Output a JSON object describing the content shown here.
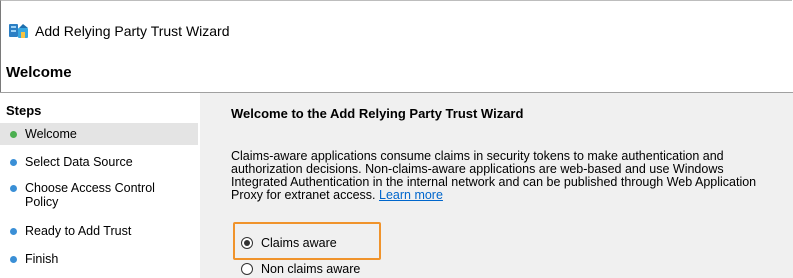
{
  "window": {
    "title": "Add Relying Party Trust Wizard",
    "icon": "relying-party-icon"
  },
  "header": {
    "title": "Welcome"
  },
  "sidebar": {
    "title": "Steps",
    "steps": [
      {
        "label": "Welcome",
        "color": "#4caf50",
        "current": true
      },
      {
        "label": "Select Data Source",
        "color": "#3a8fd6"
      },
      {
        "label": "Choose Access Control Policy",
        "color": "#3a8fd6"
      },
      {
        "label": "Ready to Add Trust",
        "color": "#3a8fd6"
      },
      {
        "label": "Finish",
        "color": "#3a8fd6"
      }
    ]
  },
  "main": {
    "heading": "Welcome to the Add Relying Party Trust Wizard",
    "description": "Claims-aware applications consume claims in security tokens to make authentication and authorization decisions. Non-claims-aware applications are web-based and use Windows Integrated Authentication in the internal network and can be published through Web Application Proxy for extranet access.",
    "learn_more": "Learn more",
    "options": [
      {
        "label": "Claims aware",
        "selected": true
      },
      {
        "label": "Non claims aware",
        "selected": false
      }
    ]
  },
  "colors": {
    "highlight": "#f0932b",
    "link": "#0066cc",
    "panel_bg": "#f0f0f0"
  }
}
